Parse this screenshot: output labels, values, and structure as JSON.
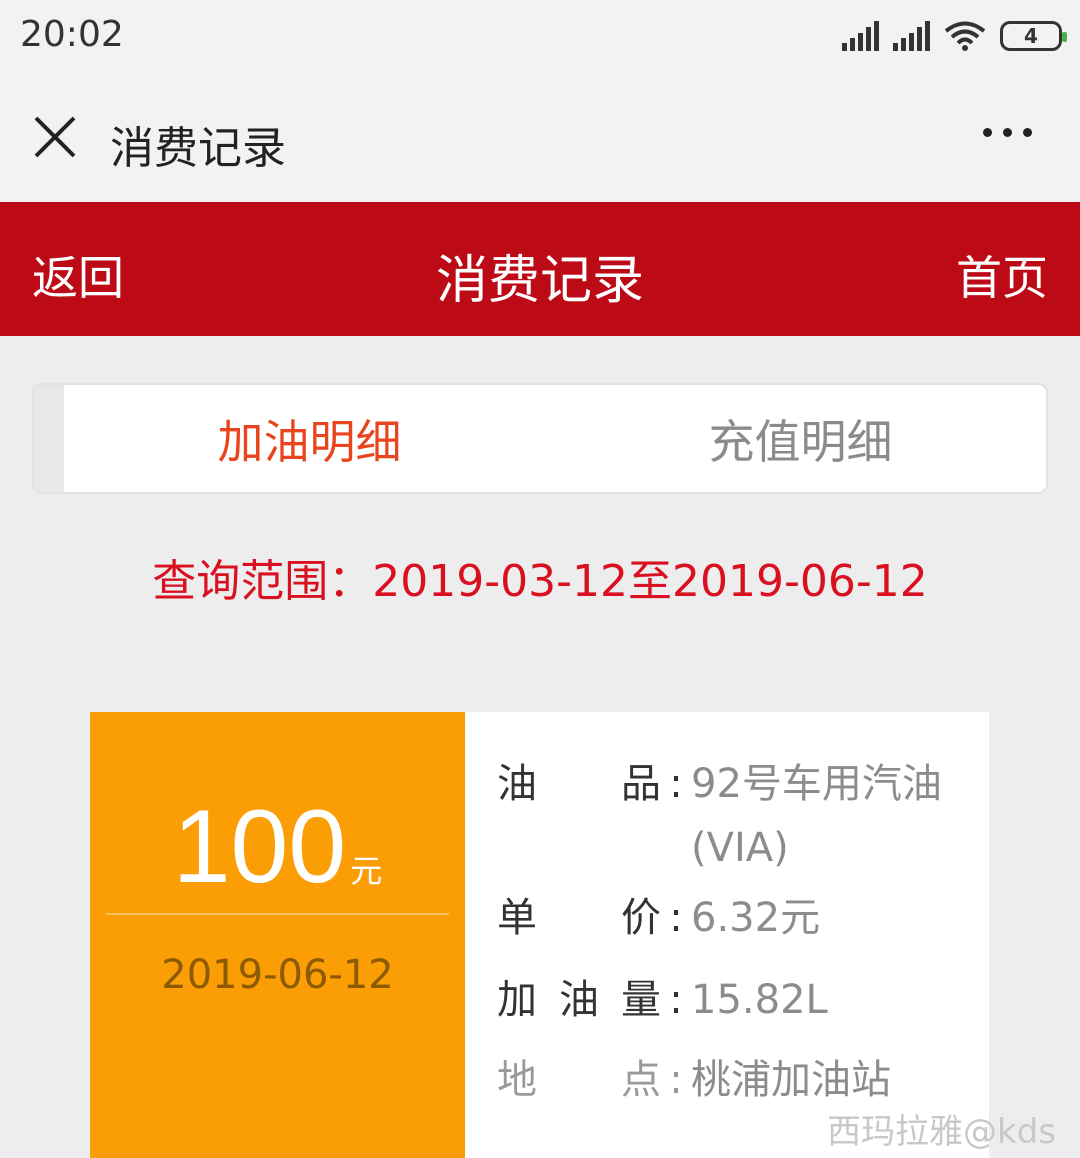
{
  "status_bar": {
    "time": "20:02",
    "battery": "4"
  },
  "nav": {
    "title": "消费记录"
  },
  "header": {
    "back": "返回",
    "title": "消费记录",
    "home": "首页"
  },
  "tabs": [
    {
      "label": "加油明细",
      "active": true
    },
    {
      "label": "充值明细",
      "active": false
    }
  ],
  "range": "查询范围：2019-03-12至2019-06-12",
  "record": {
    "amount": "100",
    "unit": "元",
    "date": "2019-06-12",
    "fields": [
      {
        "label": [
          "油",
          "品"
        ],
        "value": "92号车用汽油 (VIA)"
      },
      {
        "label": [
          "单",
          "价"
        ],
        "value": "6.32元"
      },
      {
        "label": [
          "加",
          "油",
          "量"
        ],
        "value": "15.82L"
      },
      {
        "label": [
          "地",
          "点"
        ],
        "value": "桃浦加油站"
      }
    ]
  },
  "watermark": "西玛拉雅@kds",
  "colors": {
    "header_red": "#bd0a17",
    "tab_active": "#e8451e",
    "range_red": "#d81020",
    "card_orange": "#fb9d05"
  }
}
